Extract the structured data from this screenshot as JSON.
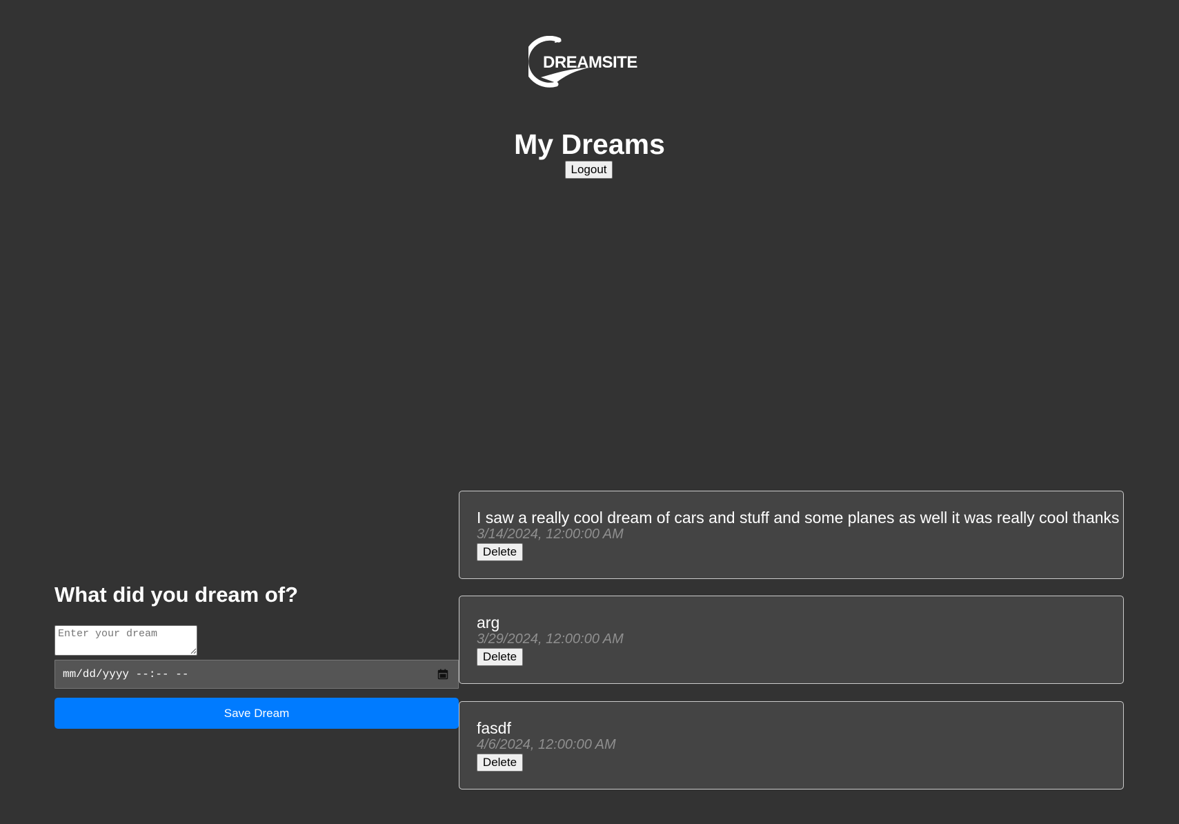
{
  "header": {
    "logo_text": "DREAMSITE",
    "title": "My Dreams",
    "logout_label": "Logout"
  },
  "form": {
    "title": "What did you dream of?",
    "dream_input": {
      "value": "",
      "placeholder": "Enter your dream"
    },
    "datetime_input": {
      "display": "mm/dd/yyyy --:-- --"
    },
    "save_label": "Save Dream"
  },
  "dreams": [
    {
      "text": "I saw a really cool dream of cars and stuff and some planes as well it was really cool thanks",
      "date": "3/14/2024, 12:00:00 AM",
      "delete_label": "Delete"
    },
    {
      "text": "arg",
      "date": "3/29/2024, 12:00:00 AM",
      "delete_label": "Delete"
    },
    {
      "text": "fasdf",
      "date": "4/6/2024, 12:00:00 AM",
      "delete_label": "Delete"
    }
  ],
  "colors": {
    "background": "#333333",
    "card_background": "#444444",
    "card_border": "#cccccc",
    "accent": "#007bff",
    "date_text": "#8f8f8f"
  },
  "icons": {
    "logo": "dreamsite-logo-icon",
    "calendar": "calendar-icon"
  }
}
